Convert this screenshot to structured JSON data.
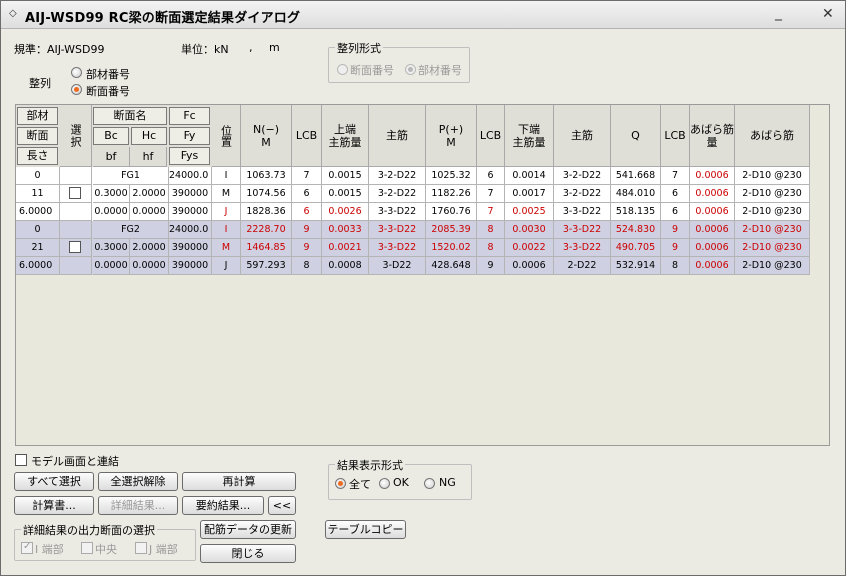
{
  "window": {
    "title": "AIJ-WSD99 RC梁の断面選定結果ダイアログ"
  },
  "info": {
    "standard": "規準：AIJ-WSD99",
    "unit_label": "単位：kN",
    "unit_sep": ",",
    "unit_m": "m"
  },
  "sort": {
    "label": "整列",
    "opt1": "部材番号",
    "opt2": "断面番号",
    "selected": "断面番号"
  },
  "sort_format": {
    "title": "整列形式",
    "opt1": "断面番号",
    "opt2": "部材番号",
    "selected": "部材番号"
  },
  "table": {
    "h_member": "部材",
    "h_section": "断面",
    "h_length": "長さ",
    "h_select": "選択",
    "h_secname": "断面名",
    "h_bc": "Bc",
    "h_hc": "Hc",
    "h_bf": "bf",
    "h_hf": "hf",
    "h_fc": "Fc",
    "h_fy": "Fy",
    "h_fys": "Fys",
    "h_pos": "位置",
    "h_nm_1": "N(−)",
    "h_nm_2": "M",
    "h_lcb": "LCB",
    "h_top_1": "上端",
    "h_top_2": "主筋量",
    "h_main": "主筋",
    "h_pm_1": "P(+)",
    "h_pm_2": "M",
    "h_bot_1": "下端",
    "h_bot_2": "主筋量",
    "h_q": "Q",
    "h_stir_1": "あばら筋",
    "h_stir_2": "量",
    "h_stir": "あばら筋",
    "groups": [
      {
        "num": "0",
        "sec": "11",
        "len": "6.0000",
        "name": "FG1",
        "bc": "0.3000",
        "hc": "2.0000",
        "bf": "0.0000",
        "hf": "0.0000",
        "fc": "24000.0",
        "fy": "390000",
        "fys": "390000",
        "rows": [
          {
            "pos": "I",
            "n": "1063.73",
            "lcb1": "7",
            "ta": "0.0015",
            "tm": "3-2-D22",
            "p": "1025.32",
            "lcb2": "6",
            "ba": "0.0014",
            "bm": "3-2-D22",
            "q": "541.668",
            "lcb3": "7",
            "sa": "0.0006",
            "sb": "2-D10 @230"
          },
          {
            "pos": "M",
            "n": "1074.56",
            "lcb1": "6",
            "ta": "0.0015",
            "tm": "3-2-D22",
            "p": "1182.26",
            "lcb2": "7",
            "ba": "0.0017",
            "bm": "3-2-D22",
            "q": "484.010",
            "lcb3": "6",
            "sa": "0.0006",
            "sb": "2-D10 @230"
          },
          {
            "pos": "J",
            "n": "1828.36",
            "lcb1": "6",
            "ta": "0.0026",
            "tm": "3-3-D22",
            "p": "1760.76",
            "lcb2": "7",
            "ba": "0.0025",
            "bm": "3-3-D22",
            "q": "518.135",
            "lcb3": "6",
            "sa": "0.0006",
            "sb": "2-D10 @230"
          }
        ]
      },
      {
        "num": "0",
        "sec": "21",
        "len": "6.0000",
        "name": "FG2",
        "bc": "0.3000",
        "hc": "2.0000",
        "bf": "0.0000",
        "hf": "0.0000",
        "fc": "24000.0",
        "fy": "390000",
        "fys": "390000",
        "rows": [
          {
            "pos": "I",
            "n": "2228.70",
            "lcb1": "9",
            "ta": "0.0033",
            "tm": "3-3-D22",
            "p": "2085.39",
            "lcb2": "8",
            "ba": "0.0030",
            "bm": "3-3-D22",
            "q": "524.830",
            "lcb3": "9",
            "sa": "0.0006",
            "sb": "2-D10 @230"
          },
          {
            "pos": "M",
            "n": "1464.85",
            "lcb1": "9",
            "ta": "0.0021",
            "tm": "3-3-D22",
            "p": "1520.02",
            "lcb2": "8",
            "ba": "0.0022",
            "bm": "3-3-D22",
            "q": "490.705",
            "lcb3": "9",
            "sa": "0.0006",
            "sb": "2-D10 @230"
          },
          {
            "pos": "J",
            "n": "597.293",
            "lcb1": "8",
            "ta": "0.0008",
            "tm": "3-D22",
            "p": "428.648",
            "lcb2": "9",
            "ba": "0.0006",
            "bm": "2-D22",
            "q": "532.914",
            "lcb3": "8",
            "sa": "0.0006",
            "sb": "2-D10 @230"
          }
        ]
      }
    ]
  },
  "link_model": {
    "label": "モデル画面と連結"
  },
  "buttons": {
    "select_all": "すべて選択",
    "deselect_all": "全選択解除",
    "recalc": "再計算",
    "report": "計算書...",
    "detail": "詳細結果...",
    "summary": "要約結果...",
    "collapse": "<<",
    "update_rebar": "配筋データの更新",
    "close": "閉じる",
    "table_copy": "テーブルコピー"
  },
  "result_format": {
    "title": "結果表示形式",
    "opt_all": "全て",
    "opt_ok": "OK",
    "opt_ng": "NG",
    "selected": "全て"
  },
  "detail_output": {
    "title": "詳細結果の出力断面の選択",
    "i_end": "I 端部",
    "center": "中央",
    "j_end": "J 端部"
  },
  "colors": {
    "ok_text": "#000000",
    "ng_text": "#cc0000",
    "selected_row": "#cfd0e1",
    "accent_radio": "#ee6a1f"
  }
}
